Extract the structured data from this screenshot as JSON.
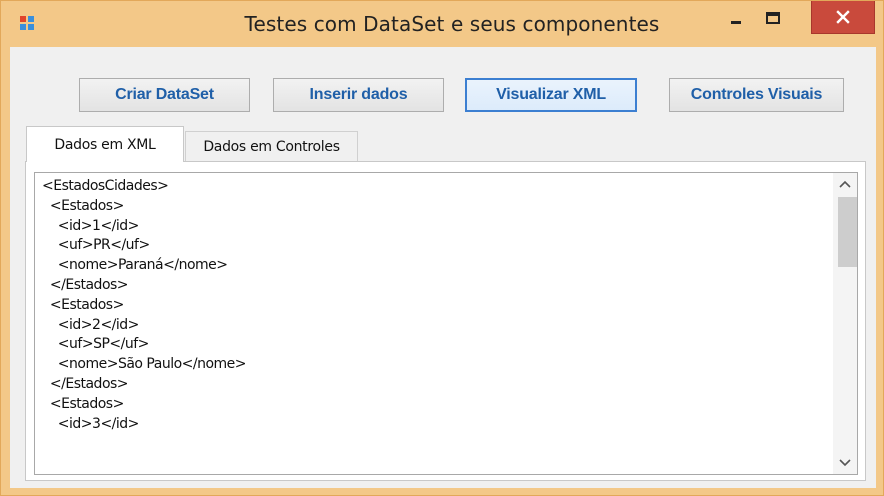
{
  "window": {
    "title": "Testes com DataSet e seus componentes",
    "controls": {
      "minimize": "minimize",
      "maximize": "maximize",
      "close": "close"
    }
  },
  "toolbar": {
    "criar_label": "Criar DataSet",
    "inserir_label": "Inserir dados",
    "visualizar_label": "Visualizar XML",
    "controles_label": "Controles Visuais"
  },
  "tabs": [
    {
      "label": "Dados em XML",
      "selected": true
    },
    {
      "label": "Dados em Controles",
      "selected": false
    }
  ],
  "xml_text": {
    "lines": [
      "<EstadosCidades>",
      "  <Estados>",
      "    <id>1</id>",
      "    <uf>PR</uf>",
      "    <nome>Paraná</nome>",
      "  </Estados>",
      "  <Estados>",
      "    <id>2</id>",
      "    <uf>SP</uf>",
      "    <nome>São Paulo</nome>",
      "  </Estados>",
      "  <Estados>",
      "    <id>3</id>"
    ]
  },
  "colors": {
    "title_bar": "#f3c888",
    "close_button": "#c94a3c",
    "button_text": "#1f5fa8",
    "focus_border": "#3c7fd1"
  },
  "icons": {
    "app": "app-window-icon",
    "minimize": "minimize-icon",
    "maximize": "maximize-icon",
    "close": "close-icon",
    "scroll_up": "chevron-up-icon",
    "scroll_down": "chevron-down-icon"
  }
}
